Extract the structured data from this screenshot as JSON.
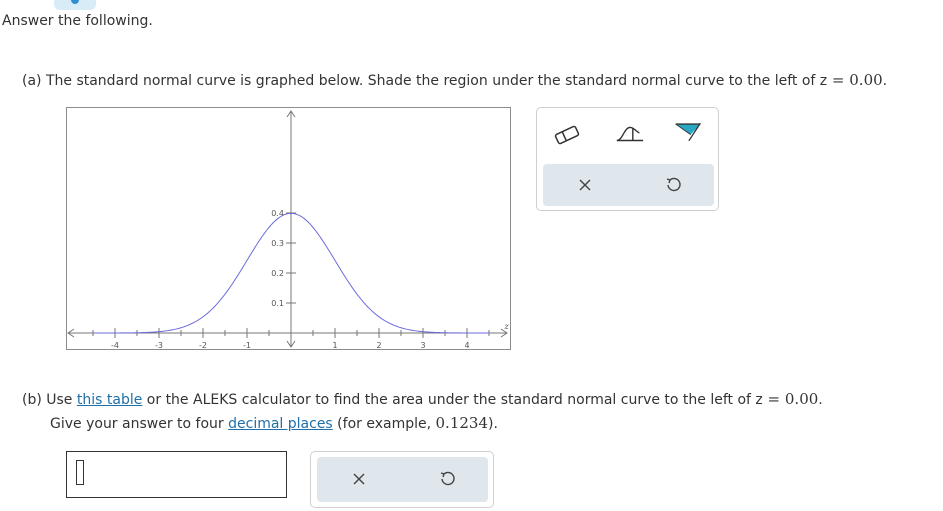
{
  "intro": "Answer the following.",
  "part_a": {
    "prefix": "(a) The standard normal curve is graphed below. Shade the region under the standard normal curve to the left of z",
    "equals": " = ",
    "value": "0.00",
    "period": "."
  },
  "graph": {
    "x_ticks": [
      "-4",
      "-3",
      "-2",
      "-1",
      "1",
      "2",
      "3",
      "4"
    ],
    "y_ticks": [
      "0.1",
      "0.2",
      "0.3",
      "0.4"
    ],
    "x_axis_label": "z",
    "curve_color": "#6b6bdc",
    "chart_data": {
      "type": "line",
      "xlim": [
        -4.5,
        4.9
      ],
      "ylim": [
        0,
        0.42
      ],
      "function": "standard normal density"
    }
  },
  "tools": {
    "eraser_icon": "eraser-icon",
    "left_tail_icon": "left-tail-icon",
    "region_icon": "shade-region-icon",
    "accent": "#29a8c5"
  },
  "part_b": {
    "line1_prefix": "(b) Use ",
    "line1_link": "this table",
    "line1_mid": " or the ALEKS calculator to find the area under the standard normal curve to the left of z",
    "equals": " = ",
    "value": "0.00",
    "period": ".",
    "line2_prefix": "Give your answer to four ",
    "line2_link": "decimal places",
    "line2_mid": " (for example, ",
    "example": "0.1234",
    "line2_end": ")."
  }
}
